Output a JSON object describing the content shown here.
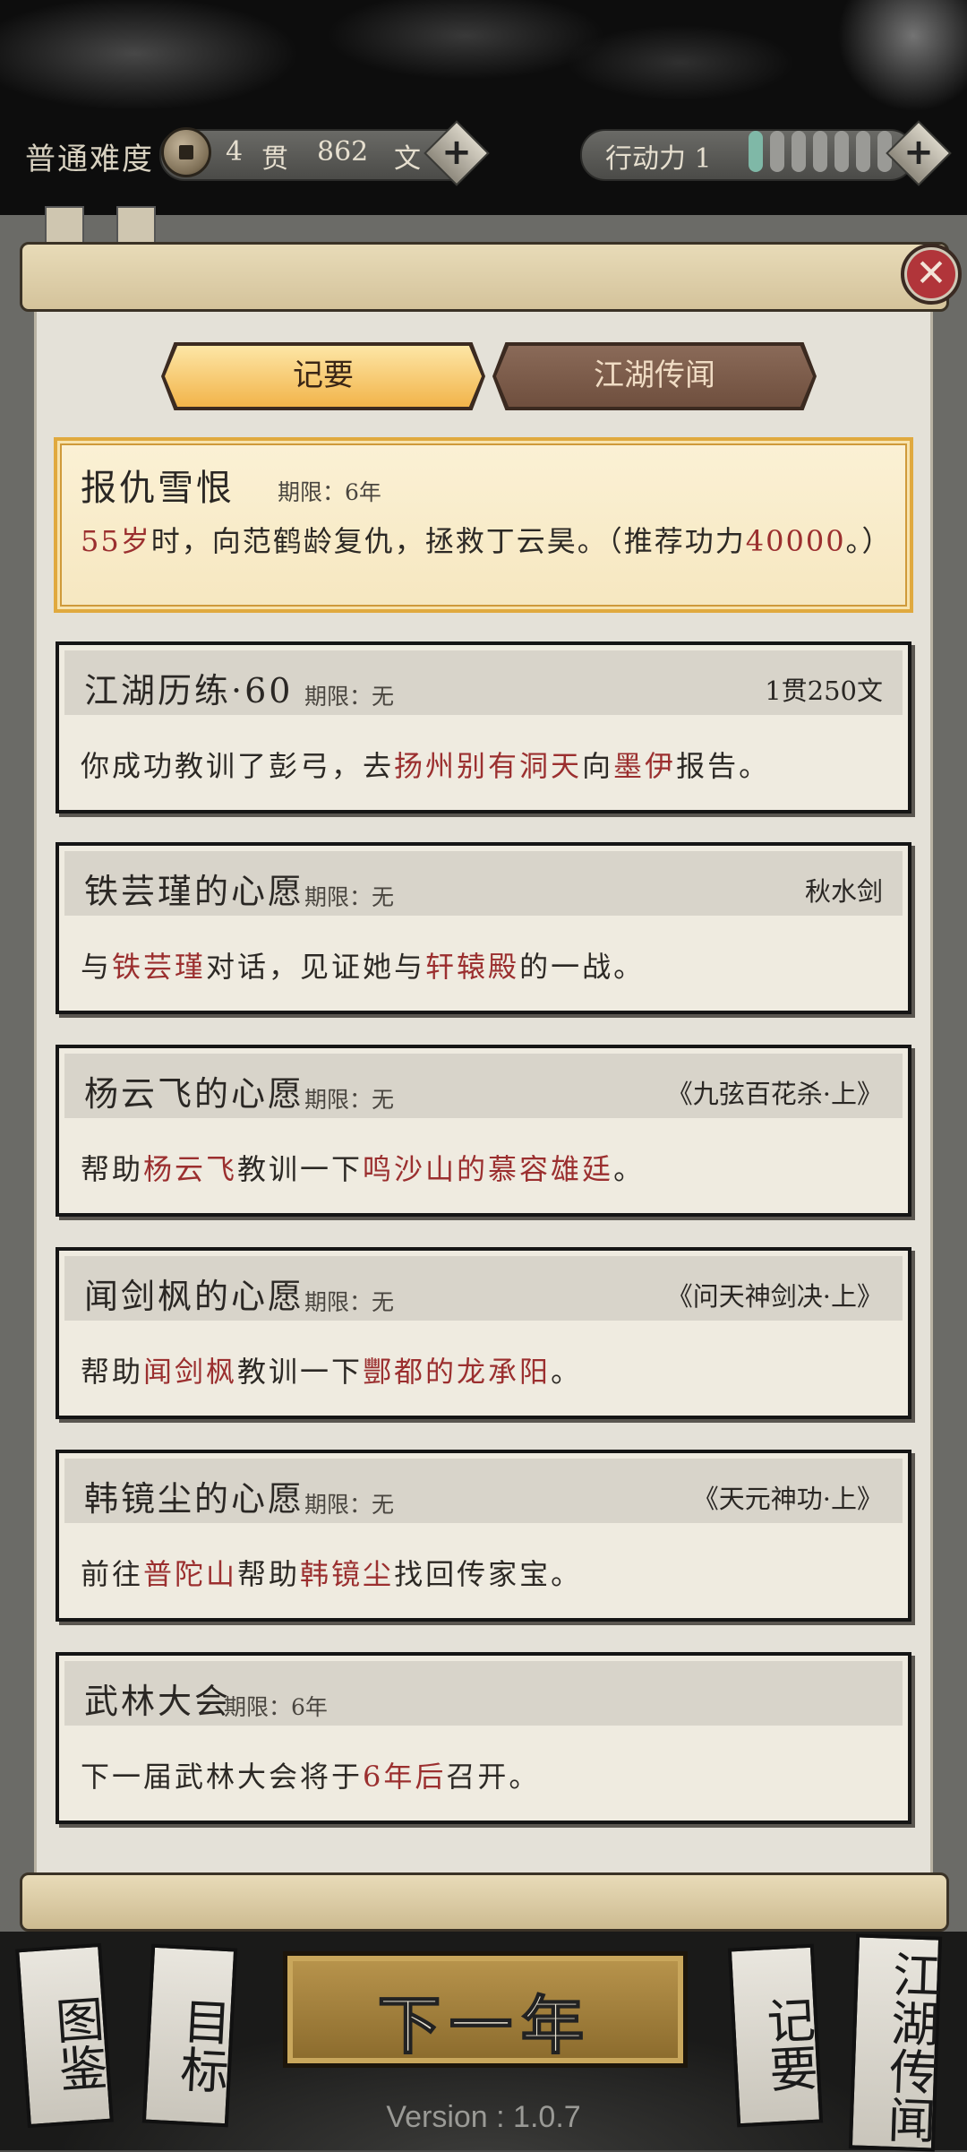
{
  "header": {
    "difficulty": "普通难度",
    "money_guan": "4",
    "money_guan_unit": "贯",
    "money_wen": "862",
    "money_wen_unit": "文",
    "stamina_label": "行动力 1",
    "stamina_level": 1,
    "stamina_max": 7
  },
  "tabs": {
    "active": "记要",
    "inactive": "江湖传闻"
  },
  "main_quest": {
    "title": "报仇雪恨",
    "deadline": "期限：6年",
    "age": "55岁",
    "body_text": "时，向范鹤龄复仇，拯救丁云昊。（推荐功力",
    "power": "40000",
    "body_end": "。）"
  },
  "quests": [
    {
      "title": "江湖历练·60",
      "deadline": "期限：无",
      "reward": "1贯250文",
      "parts": [
        "你成功教训了彭弓，去",
        "扬州别有洞天",
        "向",
        "墨伊",
        "报告。"
      ]
    },
    {
      "title": "铁芸瑾的心愿",
      "deadline": "期限：无",
      "reward": "秋水剑",
      "parts": [
        "与",
        "铁芸瑾",
        "对话，见证她与",
        "轩辕殿",
        "的一战。"
      ]
    },
    {
      "title": "杨云飞的心愿",
      "deadline": "期限：无",
      "reward": "《九弦百花杀·上》",
      "parts": [
        "帮助",
        "杨云飞",
        "教训一下",
        "鸣沙山的慕容雄廷",
        "。"
      ]
    },
    {
      "title": "闻剑枫的心愿",
      "deadline": "期限：无",
      "reward": "《问天神剑决·上》",
      "parts": [
        "帮助",
        "闻剑枫",
        "教训一下",
        "酆都的龙承阳",
        "。"
      ]
    },
    {
      "title": "韩镜尘的心愿",
      "deadline": "期限：无",
      "reward": "《天元神功·上》",
      "parts": [
        "前往",
        "普陀山",
        "帮助",
        "韩镜尘",
        "找回传家宝。"
      ]
    },
    {
      "title": "武林大会",
      "deadline": "期限：6年",
      "reward": "",
      "parts": [
        "下一届武林大会将于",
        "6年后",
        "召开。",
        "",
        ""
      ]
    }
  ],
  "bottom_nav": {
    "encyclopedia": "图鉴",
    "goals": "目标",
    "next_year": "下一年",
    "notes": "记要",
    "rumors": "江湖传闻"
  },
  "version": "Version : 1.0.7",
  "colors": {
    "highlight": "#9b2f2f",
    "tab_active": "#f2b44a",
    "close": "#b1353a"
  }
}
